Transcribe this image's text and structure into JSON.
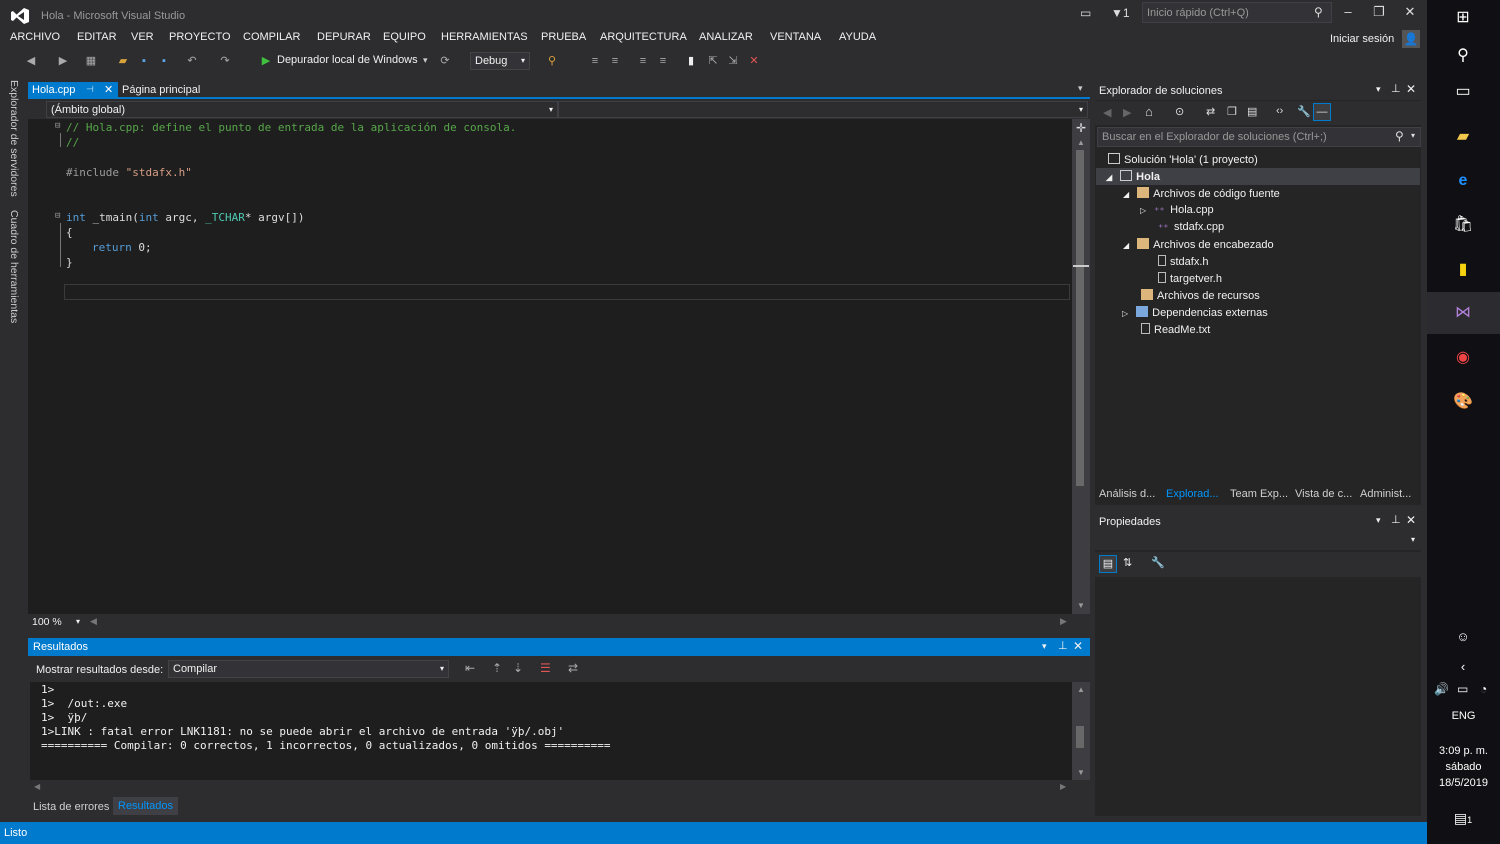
{
  "window": {
    "title": "Hola - Microsoft Visual Studio",
    "quick_launch_placeholder": "Inicio rápido (Ctrl+Q)",
    "notification_count": "1"
  },
  "menu": [
    "ARCHIVO",
    "EDITAR",
    "VER",
    "PROYECTO",
    "COMPILAR",
    "DEPURAR",
    "EQUIPO",
    "HERRAMIENTAS",
    "PRUEBA",
    "ARQUITECTURA",
    "ANALIZAR",
    "VENTANA",
    "AYUDA"
  ],
  "signin": "Iniciar sesión",
  "toolbar": {
    "debugger": "Depurador local de Windows",
    "configuration": "Debug"
  },
  "left_strip": [
    "Explorador de servidores",
    "Cuadro de herramientas"
  ],
  "editor": {
    "tabs": [
      "Hola.cpp",
      "Página principal"
    ],
    "scope": "(Ámbito global)",
    "zoom": "100 %",
    "code": {
      "line1": "// Hola.cpp: define el punto de entrada de la aplicación de consola.",
      "line2": "//",
      "include_kw": "#include",
      "include_file": "\"stdafx.h\"",
      "main_kw": "int",
      "main_name": "_tmain",
      "main_args_open": "(",
      "main_int": "int",
      "main_argc": " argc, ",
      "main_tchar": "_TCHAR",
      "main_rest": "* argv[])",
      "brace_open": "{",
      "return_kw": "return",
      "return_val": " 0;",
      "brace_close": "}"
    }
  },
  "output": {
    "title": "Resultados",
    "show_from_label": "Mostrar resultados desde:",
    "show_from_value": "Compilar",
    "lines": [
      "1>",
      "1>  /out:.exe",
      "1>  ÿþ/",
      "1>LINK : fatal error LNK1181: no se puede abrir el archivo de entrada 'ÿþ/.obj'",
      "========== Compilar: 0 correctos, 1 incorrectos, 0 actualizados, 0 omitidos =========="
    ],
    "bottom_tabs": [
      "Lista de errores",
      "Resultados"
    ]
  },
  "solution_explorer": {
    "title": "Explorador de soluciones",
    "search_placeholder": "Buscar en el Explorador de soluciones (Ctrl+;)",
    "tree": [
      {
        "label": "Solución 'Hola'  (1 proyecto)",
        "depth": 0,
        "expander": ""
      },
      {
        "label": "Hola",
        "depth": 1,
        "expander": "◢"
      },
      {
        "label": "Archivos de código fuente",
        "depth": 2,
        "expander": "◢"
      },
      {
        "label": "Hola.cpp",
        "depth": 3,
        "expander": "▷"
      },
      {
        "label": "stdafx.cpp",
        "depth": 3,
        "expander": ""
      },
      {
        "label": "Archivos de encabezado",
        "depth": 2,
        "expander": "◢"
      },
      {
        "label": "stdafx.h",
        "depth": 3,
        "expander": ""
      },
      {
        "label": "targetver.h",
        "depth": 3,
        "expander": ""
      },
      {
        "label": "Archivos de recursos",
        "depth": 2,
        "expander": ""
      },
      {
        "label": "Dependencias externas",
        "depth": 2,
        "expander": "▷"
      },
      {
        "label": "ReadMe.txt",
        "depth": 2,
        "expander": ""
      }
    ],
    "bottom_tabs": [
      "Análisis d...",
      "Explorad...",
      "Team Exp...",
      "Vista de c...",
      "Administ..."
    ]
  },
  "properties": {
    "title": "Propiedades"
  },
  "status": "Listo",
  "taskbar": {
    "lang": "ENG",
    "time": "3:09 p. m.",
    "day": "sábado",
    "date": "18/5/2019",
    "action_center_count": "1"
  },
  "colors": {
    "accent": "#007acc",
    "editor_bg": "#1e1e1e",
    "chrome_bg": "#2d2d30"
  }
}
